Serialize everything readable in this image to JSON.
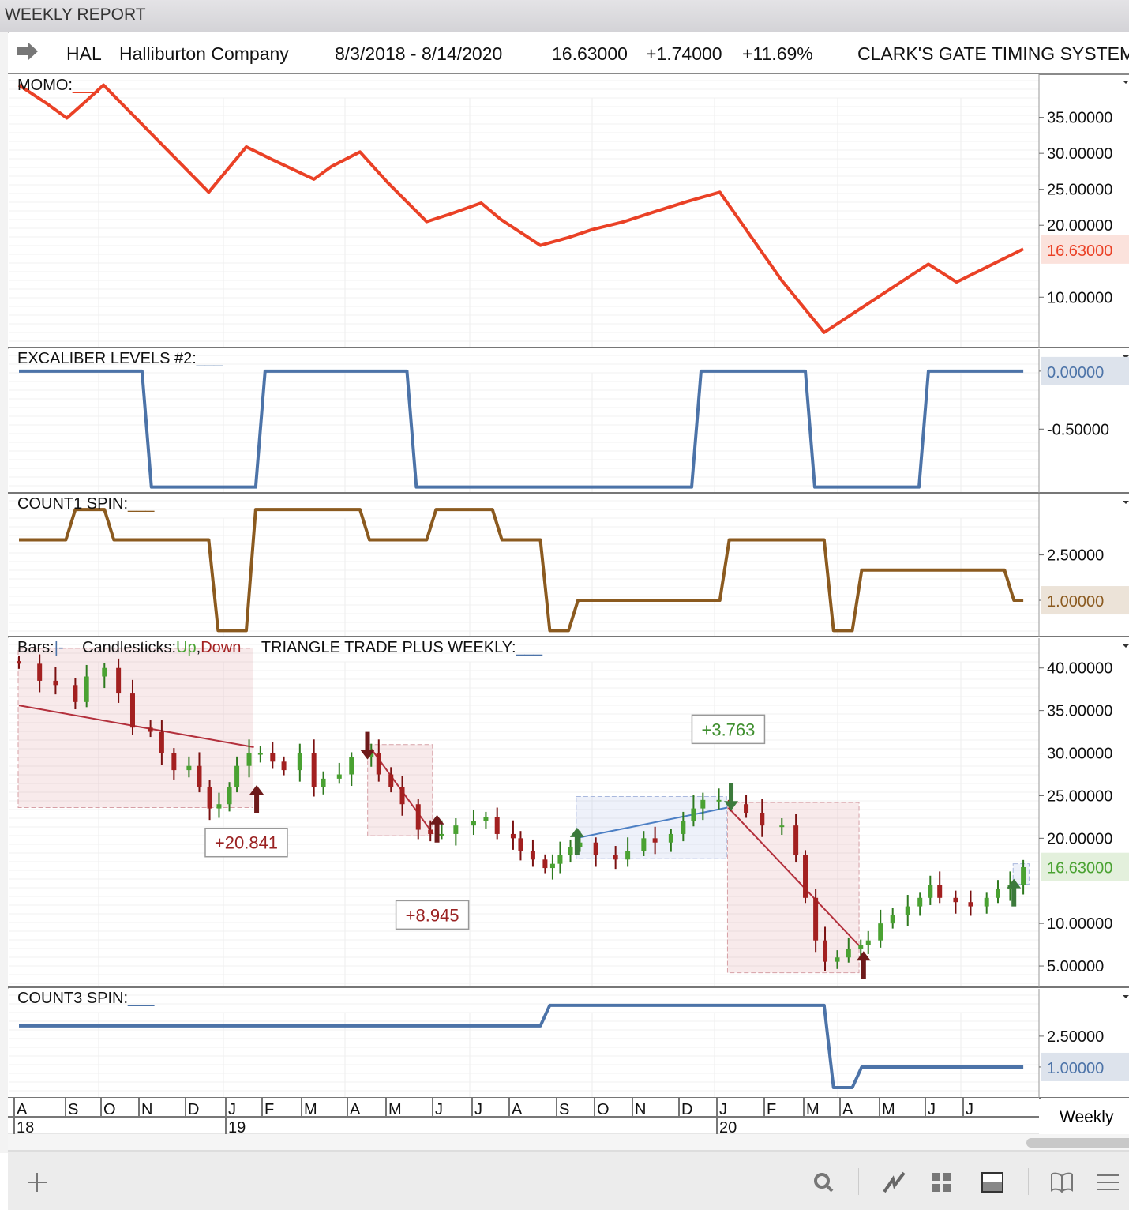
{
  "window_title": "WEEKLY REPORT",
  "info": {
    "symbol": "HAL",
    "company": "Halliburton Company",
    "range": "8/3/2018 - 8/14/2020",
    "last": "16.63000",
    "change": "+1.74000",
    "pct": "+11.69%",
    "system": "CLARK'S GATE TIMING SYSTEM"
  },
  "interval": "Weekly",
  "colors": {
    "momo": "#ea4126",
    "excaliber": "#4c73a8",
    "count1": "#8b5a1f",
    "count3": "#4c73a8",
    "up": "#4aa232",
    "down": "#a32020",
    "green_arrow": "#3c7a3c",
    "red_arrow": "#6e1a1a"
  },
  "chart_data": [
    {
      "type": "line",
      "title": "MOMO:",
      "ylim": [
        3,
        41
      ],
      "ticks": [
        "35.00000",
        "30.00000",
        "25.00000",
        "20.00000",
        "10.00000"
      ],
      "tick_values": [
        35,
        30,
        25,
        20,
        10
      ],
      "last_label": "16.63000",
      "last_value": 16.63,
      "series": [
        {
          "name": "MOMO",
          "x": [
            0,
            3,
            5.1,
            7,
            9,
            20.2,
            24.2,
            27,
            31.4,
            33.3,
            36.3,
            39.2,
            43.4,
            46,
            49.2,
            51.3,
            55.5,
            58.5,
            61,
            64.4,
            67.7,
            71.1,
            74.6,
            81.2,
            85.7,
            89.2,
            96.8,
            99.8,
            106.9
          ],
          "y": [
            39.5,
            36.9,
            34.9,
            37.1,
            39.5,
            24.6,
            30.9,
            29.1,
            26.4,
            28.2,
            30.2,
            26,
            20.5,
            21.6,
            23.1,
            20.8,
            17.2,
            18.3,
            19.4,
            20.5,
            21.9,
            23.3,
            24.6,
            12.3,
            5.1,
            8.1,
            14.6,
            12.1,
            16.7
          ]
        }
      ]
    },
    {
      "type": "line",
      "title": "EXCALIBER LEVELS #2:",
      "ylim": [
        -1.05,
        0.19
      ],
      "ticks": [
        "0.00000",
        "-0.50000"
      ],
      "tick_values": [
        0,
        -0.5
      ],
      "last_label": "0.00000",
      "last_value": 0,
      "series": [
        {
          "name": "EXCALIBER",
          "x": [
            0,
            13.1,
            14.1,
            25.2,
            26.2,
            41.3,
            42.3,
            71.6,
            72.6,
            83.7,
            84.7,
            95.8,
            96.8,
            106.9
          ],
          "y": [
            0,
            0,
            -1,
            -1,
            0,
            0,
            -1,
            -1,
            0,
            0,
            -1,
            -1,
            0,
            0
          ]
        }
      ]
    },
    {
      "type": "line",
      "title": "COUNT1 SPIN:",
      "ylim": [
        -0.2,
        4.5
      ],
      "ticks": [
        "2.50000",
        "1.00000"
      ],
      "tick_values": [
        2.5,
        1
      ],
      "last_label": "1.00000",
      "last_value": 1,
      "series": [
        {
          "name": "COUNT1",
          "x": [
            0,
            5,
            6,
            9.1,
            10.1,
            20.2,
            21.2,
            24.2,
            25.2,
            36.3,
            37.3,
            43.4,
            44.4,
            50.4,
            51.4,
            55.5,
            56.5,
            58.5,
            59.5,
            74.6,
            75.6,
            85.7,
            86.7,
            88.7,
            89.7,
            104.9,
            105.9,
            106.9
          ],
          "y": [
            3,
            3,
            4,
            4,
            3,
            3,
            0,
            0,
            4,
            4,
            3,
            3,
            4,
            4,
            3,
            3,
            0,
            0,
            1,
            1,
            3,
            3,
            0,
            0,
            2,
            2,
            1,
            1
          ]
        }
      ]
    },
    {
      "type": "candlestick",
      "title": "TRIANGLE TRADE PLUS WEEKLY:",
      "legend": {
        "bars": "Bars:",
        "bars_sym": "|-",
        "candles": "Candlesticks:",
        "up": "Up",
        "comma": ",",
        "down": "Down"
      },
      "ylim": [
        2.5,
        43.5
      ],
      "ticks": [
        "40.00000",
        "35.00000",
        "30.00000",
        "25.00000",
        "20.00000",
        "10.00000",
        "5.00000"
      ],
      "tick_values": [
        40,
        35,
        30,
        25,
        20,
        10,
        5
      ],
      "last_label": "16.63000",
      "last_value": 16.63,
      "closes": [
        [
          0,
          40.5
        ],
        [
          2.2,
          38.5
        ],
        [
          3.9,
          38
        ],
        [
          6,
          36
        ],
        [
          7.2,
          39
        ],
        [
          9.1,
          40
        ],
        [
          10.6,
          37
        ],
        [
          12.1,
          33
        ],
        [
          14,
          32.5
        ],
        [
          15.2,
          30
        ],
        [
          16.5,
          28
        ],
        [
          18.1,
          28.5
        ],
        [
          19.2,
          26
        ],
        [
          20.3,
          23.5
        ],
        [
          21.3,
          24
        ],
        [
          22.4,
          26
        ],
        [
          23.2,
          28.5
        ],
        [
          24.5,
          30
        ],
        [
          25.7,
          30
        ],
        [
          27,
          29
        ],
        [
          28.2,
          28
        ],
        [
          29.9,
          30
        ],
        [
          31.4,
          26
        ],
        [
          32.4,
          27
        ],
        [
          34.1,
          27.5
        ],
        [
          35.4,
          29.5
        ],
        [
          37.5,
          30
        ],
        [
          38.3,
          27.5
        ],
        [
          39.6,
          26
        ],
        [
          40.8,
          24
        ],
        [
          42.5,
          21
        ],
        [
          43.8,
          20.5
        ],
        [
          45,
          20.5
        ],
        [
          46.5,
          21.5
        ],
        [
          48.4,
          22
        ],
        [
          49.7,
          22.5
        ],
        [
          50.9,
          20.5
        ],
        [
          52.6,
          20
        ],
        [
          53.4,
          18.5
        ],
        [
          54.7,
          17.5
        ],
        [
          56,
          16.5
        ],
        [
          56.8,
          17
        ],
        [
          57.6,
          18
        ],
        [
          58.7,
          19
        ],
        [
          59.7,
          19.5
        ],
        [
          61.4,
          18
        ],
        [
          63.5,
          17.5
        ],
        [
          64.8,
          18.5
        ],
        [
          66.5,
          20
        ],
        [
          67.7,
          19.5
        ],
        [
          69.4,
          20.5
        ],
        [
          70.7,
          22
        ],
        [
          71.8,
          23.5
        ],
        [
          72.8,
          24.5
        ],
        [
          74.5,
          24.5
        ],
        [
          75.7,
          24
        ],
        [
          77.4,
          23
        ],
        [
          79.1,
          21.5
        ],
        [
          81.2,
          21.5
        ],
        [
          82.7,
          18
        ],
        [
          83.7,
          13
        ],
        [
          84.8,
          8
        ],
        [
          85.8,
          5.5
        ],
        [
          87.1,
          6
        ],
        [
          88.3,
          7
        ],
        [
          89.6,
          7.5
        ],
        [
          90.4,
          8
        ],
        [
          91.7,
          10
        ],
        [
          93,
          11
        ],
        [
          94.6,
          12
        ],
        [
          95.9,
          13
        ],
        [
          97,
          14.5
        ],
        [
          98,
          13
        ],
        [
          99.7,
          12.5
        ],
        [
          101.3,
          12
        ],
        [
          103,
          13
        ],
        [
          104.2,
          14
        ],
        [
          105.5,
          14.5
        ],
        [
          106.9,
          16.6
        ]
      ],
      "zones": [
        {
          "kind": "short",
          "x0": 0,
          "x1": 25,
          "y0": 23.6,
          "y1": 42.3,
          "line": [
            [
              0,
              35.6
            ],
            [
              25,
              30.7
            ]
          ]
        },
        {
          "kind": "short",
          "x0": 37.2,
          "x1": 44.1,
          "y0": 20.3,
          "y1": 31,
          "line": [
            [
              37.5,
              30.5
            ],
            [
              44.1,
              20.5
            ]
          ]
        },
        {
          "kind": "long",
          "x0": 59.4,
          "x1": 75.4,
          "y0": 17.6,
          "y1": 24.9,
          "line": [
            [
              59.7,
              20.1
            ],
            [
              75.4,
              23.6
            ]
          ]
        },
        {
          "kind": "short",
          "x0": 75.5,
          "x1": 89.5,
          "y0": 4.2,
          "y1": 24.2,
          "line": [
            [
              75.5,
              23.6
            ],
            [
              89.5,
              7.3
            ]
          ]
        },
        {
          "kind": "long",
          "x0": 105.9,
          "x1": 107.6,
          "y0": 14.6,
          "y1": 17
        }
      ],
      "arrows": [
        {
          "x": 37.1,
          "dir": "down",
          "color": "red",
          "at": 32.5
        },
        {
          "x": 25.3,
          "dir": "up",
          "color": "red",
          "at": 23
        },
        {
          "x": 44.5,
          "dir": "up",
          "color": "red",
          "at": 19.5
        },
        {
          "x": 89.9,
          "dir": "up",
          "color": "red",
          "at": 3.5
        },
        {
          "x": 59.4,
          "dir": "up",
          "color": "green",
          "at": 18
        },
        {
          "x": 105.9,
          "dir": "up",
          "color": "green",
          "at": 12
        },
        {
          "x": 75.8,
          "dir": "down",
          "color": "green",
          "at": 26.5
        }
      ],
      "annotations": [
        {
          "text": "+20.841",
          "x": 24.2,
          "y": 19.5,
          "color": "red"
        },
        {
          "text": "+8.945",
          "x": 44,
          "y": 11,
          "color": "red"
        },
        {
          "text": "+3.763",
          "x": 75.5,
          "y": 32.8,
          "color": "green"
        }
      ]
    },
    {
      "type": "line",
      "title": "COUNT3 SPIN:",
      "ylim": [
        -0.5,
        4.8
      ],
      "ticks": [
        "2.50000",
        "1.00000"
      ],
      "tick_values": [
        2.5,
        1
      ],
      "last_label": "1.00000",
      "last_value": 1,
      "series": [
        {
          "name": "COUNT3",
          "x": [
            0,
            55.5,
            56.5,
            85.7,
            86.7,
            88.7,
            89.7,
            106.9
          ],
          "y": [
            3,
            3,
            4,
            4,
            0,
            0,
            1,
            1
          ]
        }
      ]
    }
  ],
  "x_axis": {
    "months": [
      "A",
      "S",
      "O",
      "N",
      "D",
      "J",
      "F",
      "M",
      "A",
      "M",
      "J",
      "J",
      "A",
      "S",
      "O",
      "N",
      "D",
      "J",
      "F",
      "M",
      "A",
      "M",
      "J",
      "J"
    ],
    "years": [
      "18",
      "19",
      "20"
    ]
  }
}
